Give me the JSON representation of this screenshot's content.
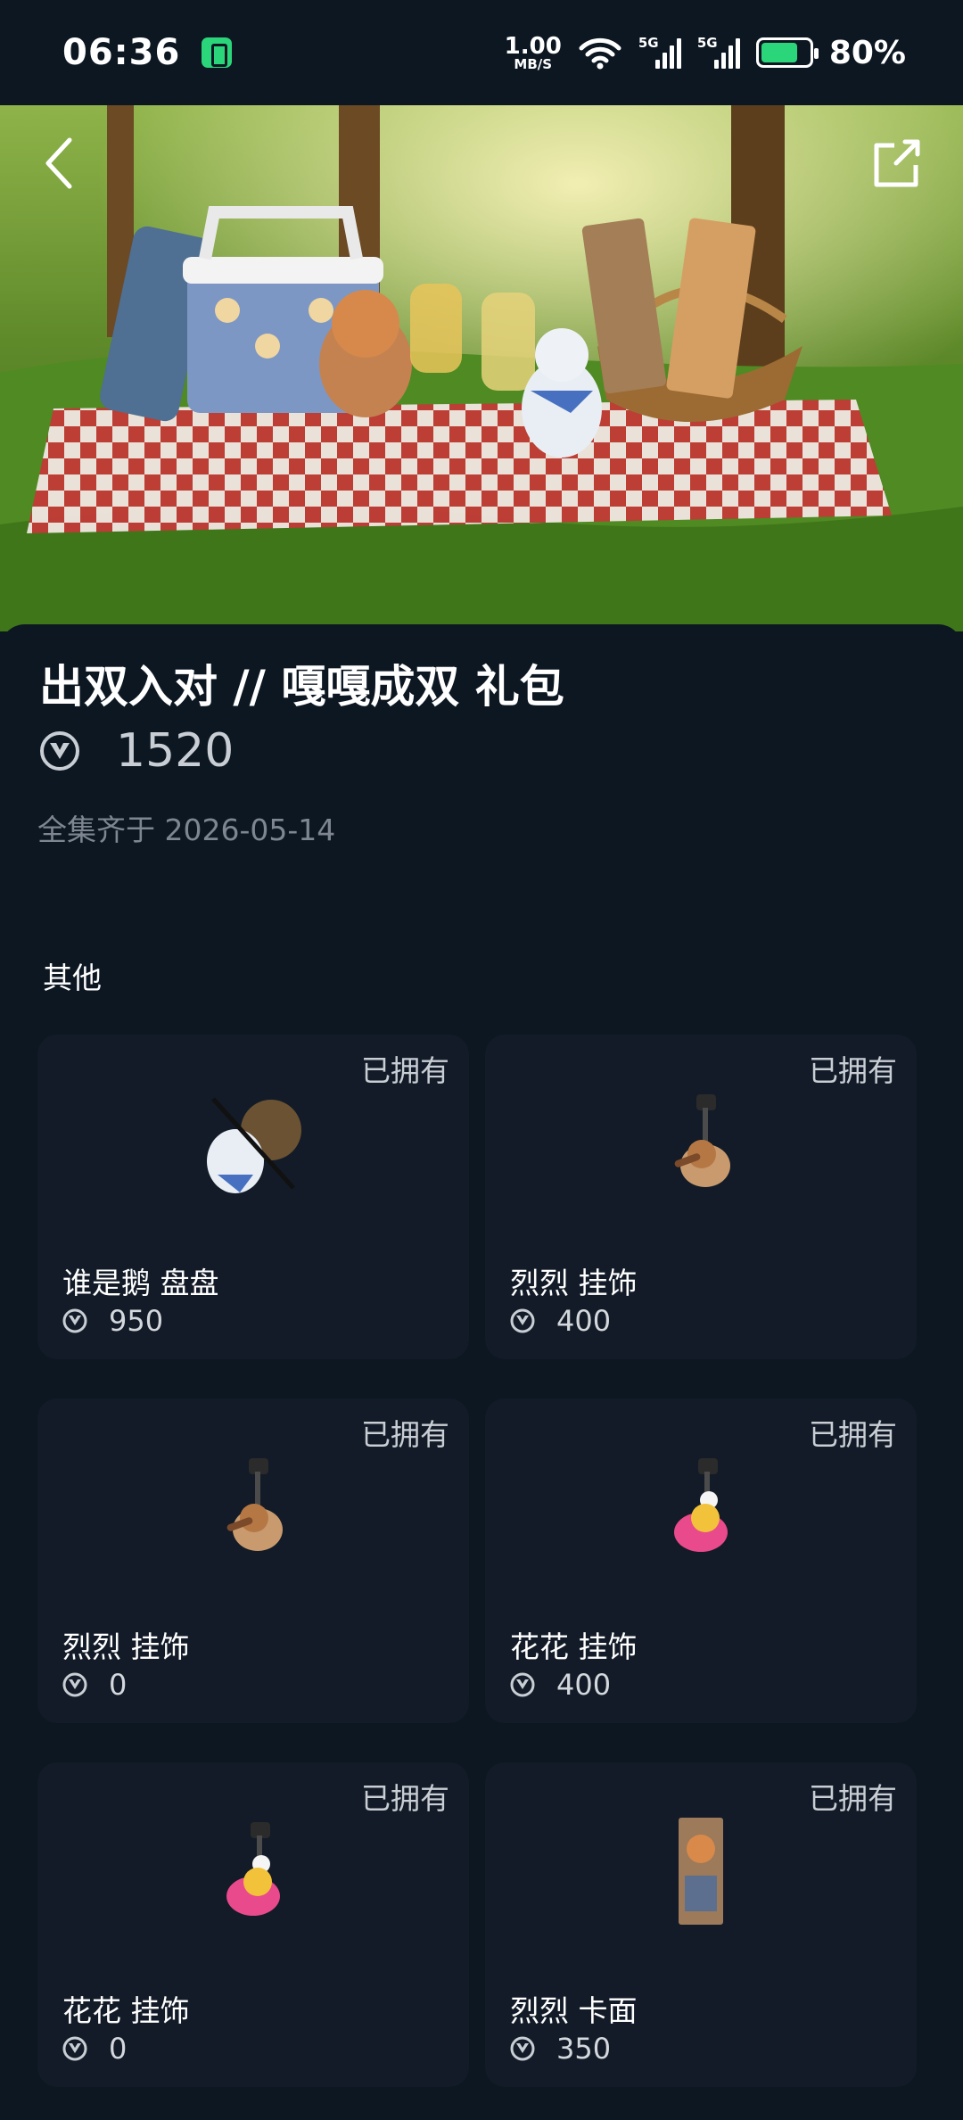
{
  "status": {
    "time": "06:36",
    "speed_value": "1.00",
    "speed_unit": "MB/S",
    "sig1": "5G",
    "sig2": "5G",
    "battery": "80%"
  },
  "bundle": {
    "title": "出双入对 // 嘎嘎成双 礼包",
    "price": "1520",
    "collected": "全集齐于 2026-05-14"
  },
  "section_title": "其他",
  "items": [
    {
      "name": "谁是鹅 盘盘",
      "price": "950",
      "status": "已拥有",
      "icon": "duck-pair-sticker-icon"
    },
    {
      "name": "烈烈 挂饰",
      "price": "400",
      "status": "已拥有",
      "icon": "keychain-charm-icon"
    },
    {
      "name": "烈烈 挂饰",
      "price": "0",
      "status": "已拥有",
      "icon": "keychain-charm-icon"
    },
    {
      "name": "花花 挂饰",
      "price": "400",
      "status": "已拥有",
      "icon": "keychain-charm-pink-icon"
    },
    {
      "name": "花花 挂饰",
      "price": "0",
      "status": "已拥有",
      "icon": "keychain-charm-pink-icon"
    },
    {
      "name": "烈烈 卡面",
      "price": "350",
      "status": "已拥有",
      "icon": "player-card-icon"
    }
  ],
  "colors": {
    "bg": "#0c1722",
    "card": "#121b27",
    "muted": "#7e8791",
    "accent_green": "#2bd67b"
  }
}
